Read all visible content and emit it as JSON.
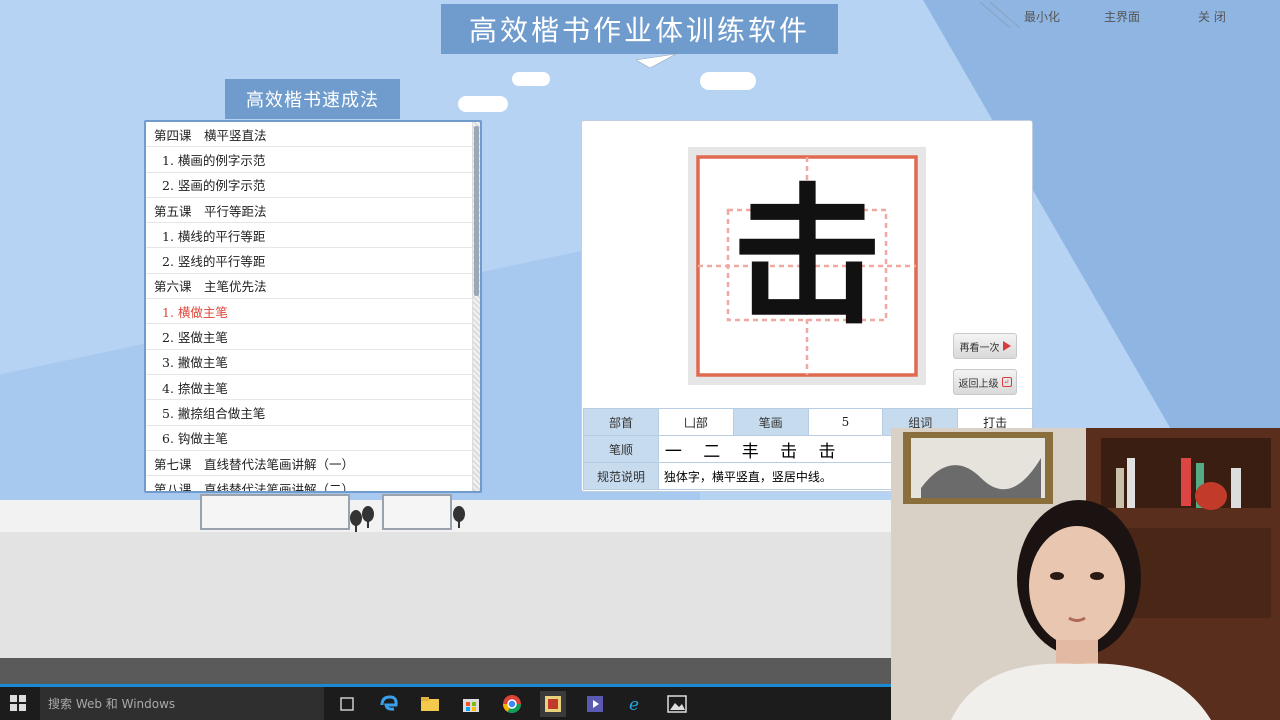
{
  "window": {
    "title": "高效楷书作业体训练软件",
    "controls": {
      "minimize": "最小化",
      "home": "主界面",
      "close": "关 闭"
    }
  },
  "section_tab": "高效楷书速成法",
  "lessons": [
    {
      "label": "第四课　横平竖直法",
      "kind": "lesson"
    },
    {
      "label": "1.  横画的例字示范",
      "kind": "item"
    },
    {
      "label": "2.  竖画的例字示范",
      "kind": "item"
    },
    {
      "label": "第五课　平行等距法",
      "kind": "lesson"
    },
    {
      "label": "1.  横线的平行等距",
      "kind": "item"
    },
    {
      "label": "2.  竖线的平行等距",
      "kind": "item"
    },
    {
      "label": "第六课　主笔优先法",
      "kind": "lesson"
    },
    {
      "label": "1.  横做主笔",
      "kind": "item",
      "active": true
    },
    {
      "label": "2.  竖做主笔",
      "kind": "item"
    },
    {
      "label": "3.  撇做主笔",
      "kind": "item"
    },
    {
      "label": "4.  捺做主笔",
      "kind": "item"
    },
    {
      "label": "5.  撇捺组合做主笔",
      "kind": "item"
    },
    {
      "label": "6.  钩做主笔",
      "kind": "item"
    },
    {
      "label": "第七课　直线替代法笔画讲解（一）",
      "kind": "lesson"
    },
    {
      "label": "第八课　直线替代法笔画讲解（二）",
      "kind": "lesson"
    }
  ],
  "character": {
    "glyph": "击",
    "buttons": {
      "replay": "再看一次",
      "back": "返回上级"
    },
    "info": {
      "radical_label": "部首",
      "radical_value": "凵部",
      "strokes_label": "笔画",
      "strokes_value": "5",
      "words_label": "组词",
      "words_value": "打击",
      "order_label": "笔顺",
      "order_value": "一 二 丰 击 击",
      "rule_label": "规范说明",
      "rule_value": "独体字，横平竖直，竖居中线。"
    }
  },
  "taskbar": {
    "search_placeholder": "搜索 Web 和 Windows",
    "icons": [
      "task-view-icon",
      "edge-icon",
      "file-explorer-icon",
      "store-icon",
      "chrome-icon",
      "calligraphy-app-icon",
      "media-icon",
      "ie-icon",
      "photos-icon"
    ]
  },
  "colors": {
    "accent": "#6f9ccd",
    "active_item": "#e0453a",
    "grid_border": "#e06a50"
  }
}
